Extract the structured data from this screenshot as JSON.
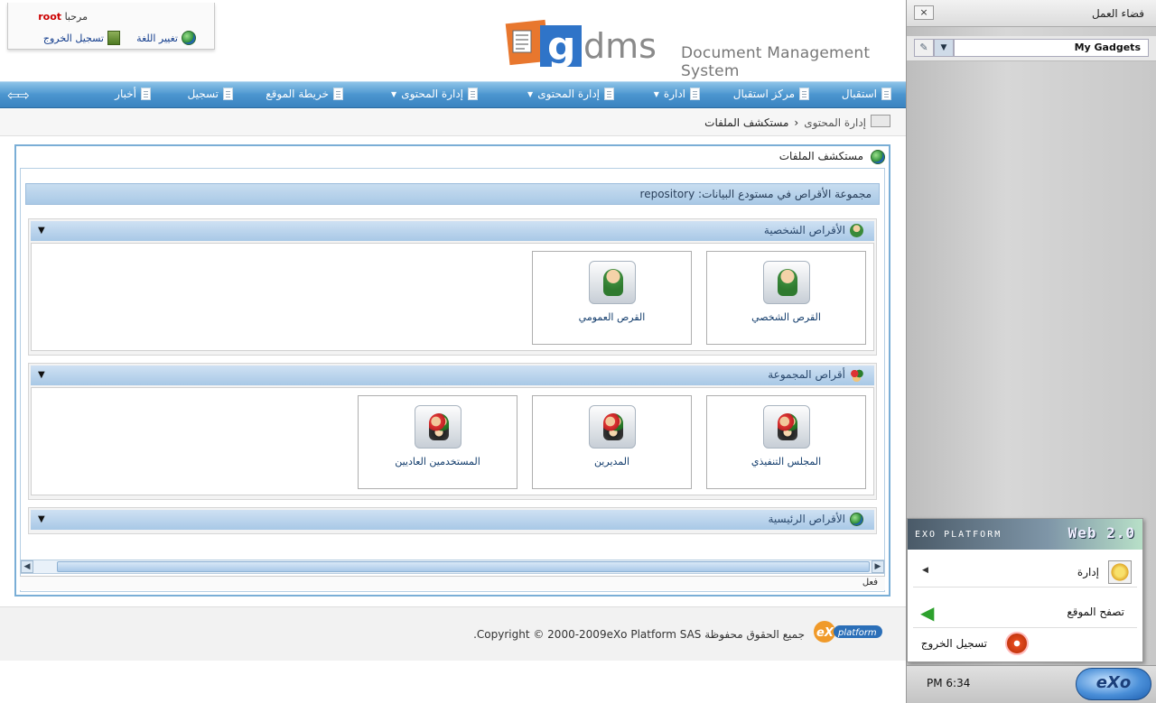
{
  "header": {
    "welcome_label": "مرحبا",
    "user": "root",
    "change_language": "تغيير اللغة",
    "logout": "تسجيل الخروج",
    "logo_text": "dms",
    "system_title": "Document Management System"
  },
  "nav": {
    "items": [
      {
        "label": "استقبال",
        "has_dropdown": false
      },
      {
        "label": "مركز استقبال",
        "has_dropdown": false
      },
      {
        "label": "ادارة",
        "has_dropdown": true
      },
      {
        "label": "إدارة المحتوى",
        "has_dropdown": true
      },
      {
        "label": "إدارة المحتوى",
        "has_dropdown": true
      },
      {
        "label": "خريطة الموقع",
        "has_dropdown": false
      },
      {
        "label": "تسجيل",
        "has_dropdown": false
      },
      {
        "label": "أخبار",
        "has_dropdown": false
      }
    ]
  },
  "breadcrumb": {
    "parent": "إدارة المحتوى",
    "current": "مستكشف الملفات"
  },
  "portlet": {
    "title": "مستكشف الملفات",
    "repository_title": "مجموعة الأقراص في مستودع البيانات: repository",
    "groups": [
      {
        "title": "الأقراص الشخصية",
        "drives": [
          {
            "label": "القرص الشخصي",
            "icon": "personal-drive-icon"
          },
          {
            "label": "القرص العمومي",
            "icon": "public-drive-icon"
          }
        ]
      },
      {
        "title": "أقراص المجموعة",
        "drives": [
          {
            "label": "المجلس التنفيذي",
            "icon": "group-drive-icon"
          },
          {
            "label": "المديرين",
            "icon": "group-drive-icon"
          },
          {
            "label": "المستخدمين العاديين",
            "icon": "group-drive-icon"
          }
        ]
      },
      {
        "title": "الأقراص الرئيسية",
        "drives": []
      }
    ],
    "status": "فعل"
  },
  "footer": {
    "copyright": "جميع الحقوق محفوظة Copyright © 2000-2009eXo Platform SAS."
  },
  "workspace": {
    "title": "فضاء العمل",
    "close": "×",
    "gadget_select": "My Gadgets",
    "banner_brand": "EXO PLATFORM",
    "banner_web": "Web 2.0",
    "start_menu": {
      "admin": "إدارة",
      "browse": "تصفح الموقع",
      "logout": "تسجيل الخروج"
    },
    "clock": "PM 6:34",
    "exo_button": "eXo"
  },
  "colors": {
    "nav_blue": "#4b95cf",
    "panel_blue": "#a9c9e6",
    "link_blue": "#123c8c",
    "user_red": "#cc0000"
  }
}
